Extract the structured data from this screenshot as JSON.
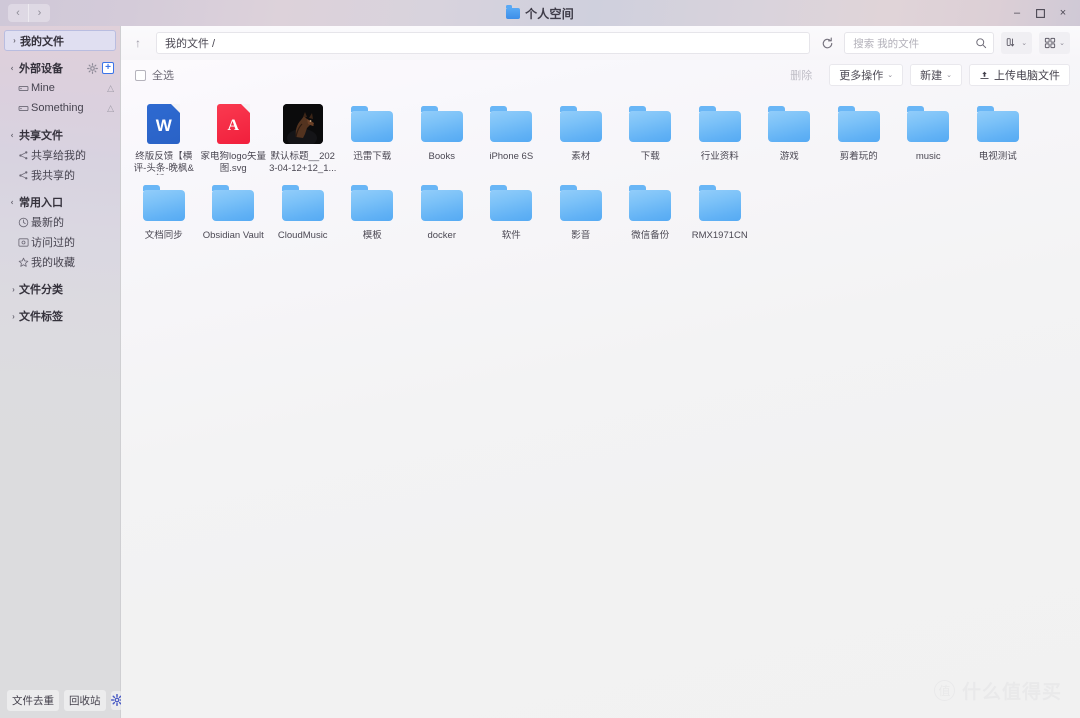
{
  "window": {
    "title": "个人空间",
    "nav_back": "‹",
    "nav_forward": "›",
    "minimize": "–",
    "maximize": "☐",
    "close": "×"
  },
  "sidebar": {
    "my_files": {
      "label": "我的文件",
      "caret": "›"
    },
    "groups": [
      {
        "label": "外部设备",
        "caret": "⌄",
        "gear": "⚙",
        "plus": "+",
        "items": [
          {
            "label": "Mine",
            "icon": "device-icon",
            "badge": "△"
          },
          {
            "label": "Something",
            "icon": "device-icon",
            "badge": "△"
          }
        ]
      },
      {
        "label": "共享文件",
        "caret": "⌄",
        "items": [
          {
            "label": "共享给我的",
            "icon": "share-in-icon"
          },
          {
            "label": "我共享的",
            "icon": "share-out-icon"
          }
        ]
      },
      {
        "label": "常用入口",
        "caret": "⌄",
        "items": [
          {
            "label": "最新的",
            "icon": "clock-icon"
          },
          {
            "label": "访问过的",
            "icon": "history-icon"
          },
          {
            "label": "我的收藏",
            "icon": "star-icon"
          }
        ]
      }
    ],
    "collapsed": [
      {
        "label": "文件分类",
        "caret": "›"
      },
      {
        "label": "文件标签",
        "caret": "›"
      }
    ],
    "bottom": {
      "dedupe": "文件去重",
      "recycle": "回收站",
      "settings_icon": "gear-icon"
    }
  },
  "addressbar": {
    "up_icon": "↑",
    "path": "我的文件 /",
    "refresh_icon": "↻",
    "search_placeholder": "搜索 我的文件",
    "search_icon": "search-icon",
    "sort_icon": "sort-icon",
    "view_icon": "grid-view-icon",
    "chevron": "⌄"
  },
  "actionbar": {
    "select_all": "全选",
    "delete": "删除",
    "more_actions": "更多操作",
    "new": "新建",
    "upload": "上传电脑文件",
    "upload_icon": "⇧",
    "chevron": "⌄"
  },
  "files": [
    {
      "name": "终版反馈【横评-头条-晚枫&新...",
      "type": "word",
      "glyph": "W"
    },
    {
      "name": "家电狗logo矢量图.svg",
      "type": "adobe",
      "glyph": "A"
    },
    {
      "name": "默认标题__2023-04-12+12_1...",
      "type": "photo"
    },
    {
      "name": "迅雷下载",
      "type": "folder"
    },
    {
      "name": "Books",
      "type": "folder"
    },
    {
      "name": "iPhone 6S",
      "type": "folder"
    },
    {
      "name": "素材",
      "type": "folder"
    },
    {
      "name": "下载",
      "type": "folder"
    },
    {
      "name": "行业资料",
      "type": "folder"
    },
    {
      "name": "游戏",
      "type": "folder"
    },
    {
      "name": "剪着玩的",
      "type": "folder"
    },
    {
      "name": "music",
      "type": "folder"
    },
    {
      "name": "电视测试",
      "type": "folder"
    },
    {
      "name": "文档同步",
      "type": "folder"
    },
    {
      "name": "Obsidian Vault",
      "type": "folder"
    },
    {
      "name": "CloudMusic",
      "type": "folder"
    },
    {
      "name": "模板",
      "type": "folder"
    },
    {
      "name": "docker",
      "type": "folder"
    },
    {
      "name": "软件",
      "type": "folder"
    },
    {
      "name": "影音",
      "type": "folder"
    },
    {
      "name": "微信备份",
      "type": "folder"
    },
    {
      "name": "RMX1971CN",
      "type": "folder"
    }
  ],
  "watermark": {
    "logo": "值",
    "text": "什么值得买"
  },
  "colors": {
    "accent_blue": "#3b74e8",
    "folder_blue": "#62b2f5",
    "word_blue": "#2e6ad1",
    "adobe_red": "#f11f3c",
    "sidebar_active": "#e0e2f4"
  }
}
